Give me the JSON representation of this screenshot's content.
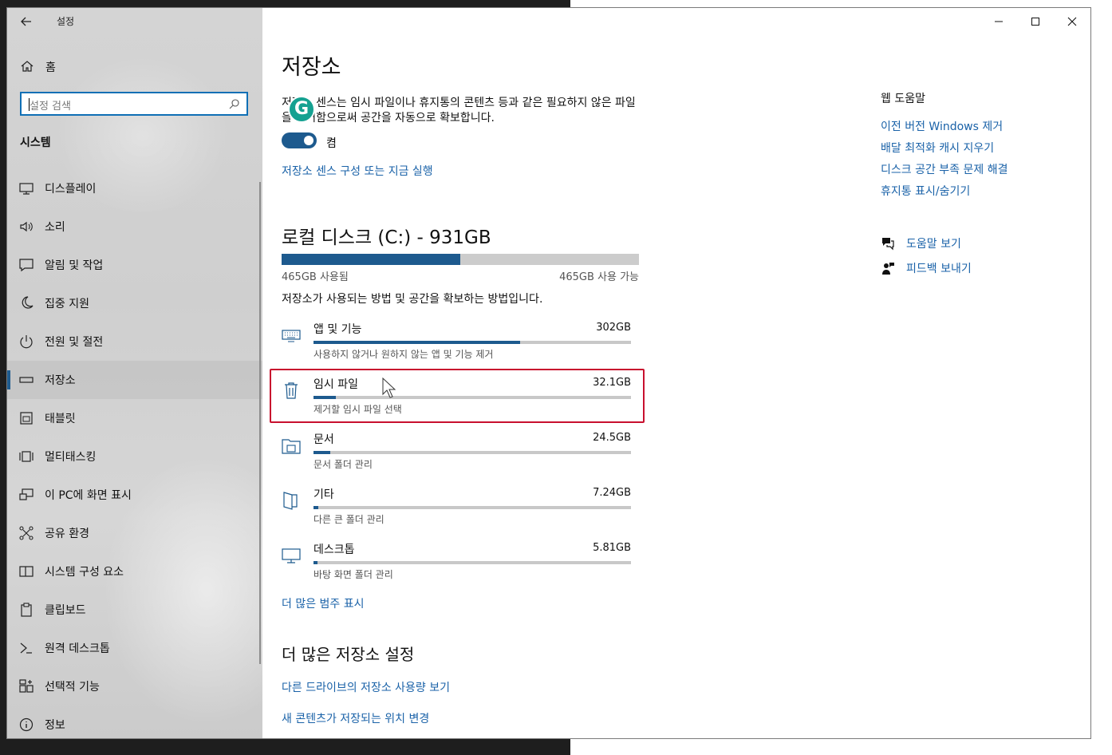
{
  "app": {
    "title": "설정"
  },
  "sidebar": {
    "home_label": "홈",
    "search_placeholder": "설정 검색",
    "section_title": "시스템",
    "items": [
      {
        "label": "디스플레이",
        "icon": "monitor-icon"
      },
      {
        "label": "소리",
        "icon": "speaker-icon"
      },
      {
        "label": "알림 및 작업",
        "icon": "notification-icon"
      },
      {
        "label": "집중 지원",
        "icon": "moon-icon"
      },
      {
        "label": "전원 및 절전",
        "icon": "power-icon"
      },
      {
        "label": "저장소",
        "icon": "storage-icon",
        "selected": true
      },
      {
        "label": "태블릿",
        "icon": "tablet-icon"
      },
      {
        "label": "멀티태스킹",
        "icon": "multitasking-icon"
      },
      {
        "label": "이 PC에 화면 표시",
        "icon": "project-icon"
      },
      {
        "label": "공유 환경",
        "icon": "share-icon"
      },
      {
        "label": "시스템 구성 요소",
        "icon": "components-icon"
      },
      {
        "label": "클립보드",
        "icon": "clipboard-icon"
      },
      {
        "label": "원격 데스크톱",
        "icon": "remote-desktop-icon"
      },
      {
        "label": "선택적 기능",
        "icon": "features-icon"
      },
      {
        "label": "정보",
        "icon": "info-icon"
      }
    ]
  },
  "main": {
    "title": "저장소",
    "description": "저장소 센스는 임시 파일이나 휴지통의 콘텐츠 등과 같은 필요하지 않은 파일을 제거함으로써 공간을 자동으로 확보합니다.",
    "toggle_label": "켬",
    "toggle_on": true,
    "sense_link": "저장소 센스 구성 또는 지금 실행",
    "disk": {
      "title": "로컬 디스크 (C:) - 931GB",
      "used_label": "465GB 사용됨",
      "free_label": "465GB 사용 가능",
      "used_fraction": 0.5,
      "description": "저장소가 사용되는 방법 및 공간을 확보하는 방법입니다."
    },
    "categories": [
      {
        "name": "앱 및 기능",
        "size": "302GB",
        "sub": "사용하지 않거나 원하지 않는 앱 및 기능 제거",
        "fraction": 0.65,
        "icon": "keyboard-icon"
      },
      {
        "name": "임시 파일",
        "size": "32.1GB",
        "sub": "제거할 임시 파일 선택",
        "fraction": 0.07,
        "icon": "trash-icon"
      },
      {
        "name": "문서",
        "size": "24.5GB",
        "sub": "문서 폴더 관리",
        "fraction": 0.053,
        "icon": "folder-icon"
      },
      {
        "name": "기타",
        "size": "7.24GB",
        "sub": "다른 큰 폴더 관리",
        "fraction": 0.016,
        "icon": "other-icon"
      },
      {
        "name": "데스크톱",
        "size": "5.81GB",
        "sub": "바탕 화면 폴더 관리",
        "fraction": 0.012,
        "icon": "desktop-icon"
      }
    ],
    "more_categories_link": "더 많은 범주 표시",
    "more_settings_title": "더 많은 저장소 설정",
    "other_drives_link": "다른 드라이브의 저장소 사용량 보기",
    "change_location_link": "새 콘텐츠가 저장되는 위치 변경"
  },
  "right": {
    "web_help_title": "웹 도움말",
    "links": [
      "이전 버전 Windows 제거",
      "배달 최적화 캐시 지우기",
      "디스크 공간 부족 문제 해결",
      "휴지통 표시/숨기기"
    ],
    "get_help": "도움말 보기",
    "feedback": "피드백 보내기"
  },
  "colors": {
    "accent": "#1d5a8e",
    "link": "#1a62a8",
    "highlight": "#c8102e"
  }
}
